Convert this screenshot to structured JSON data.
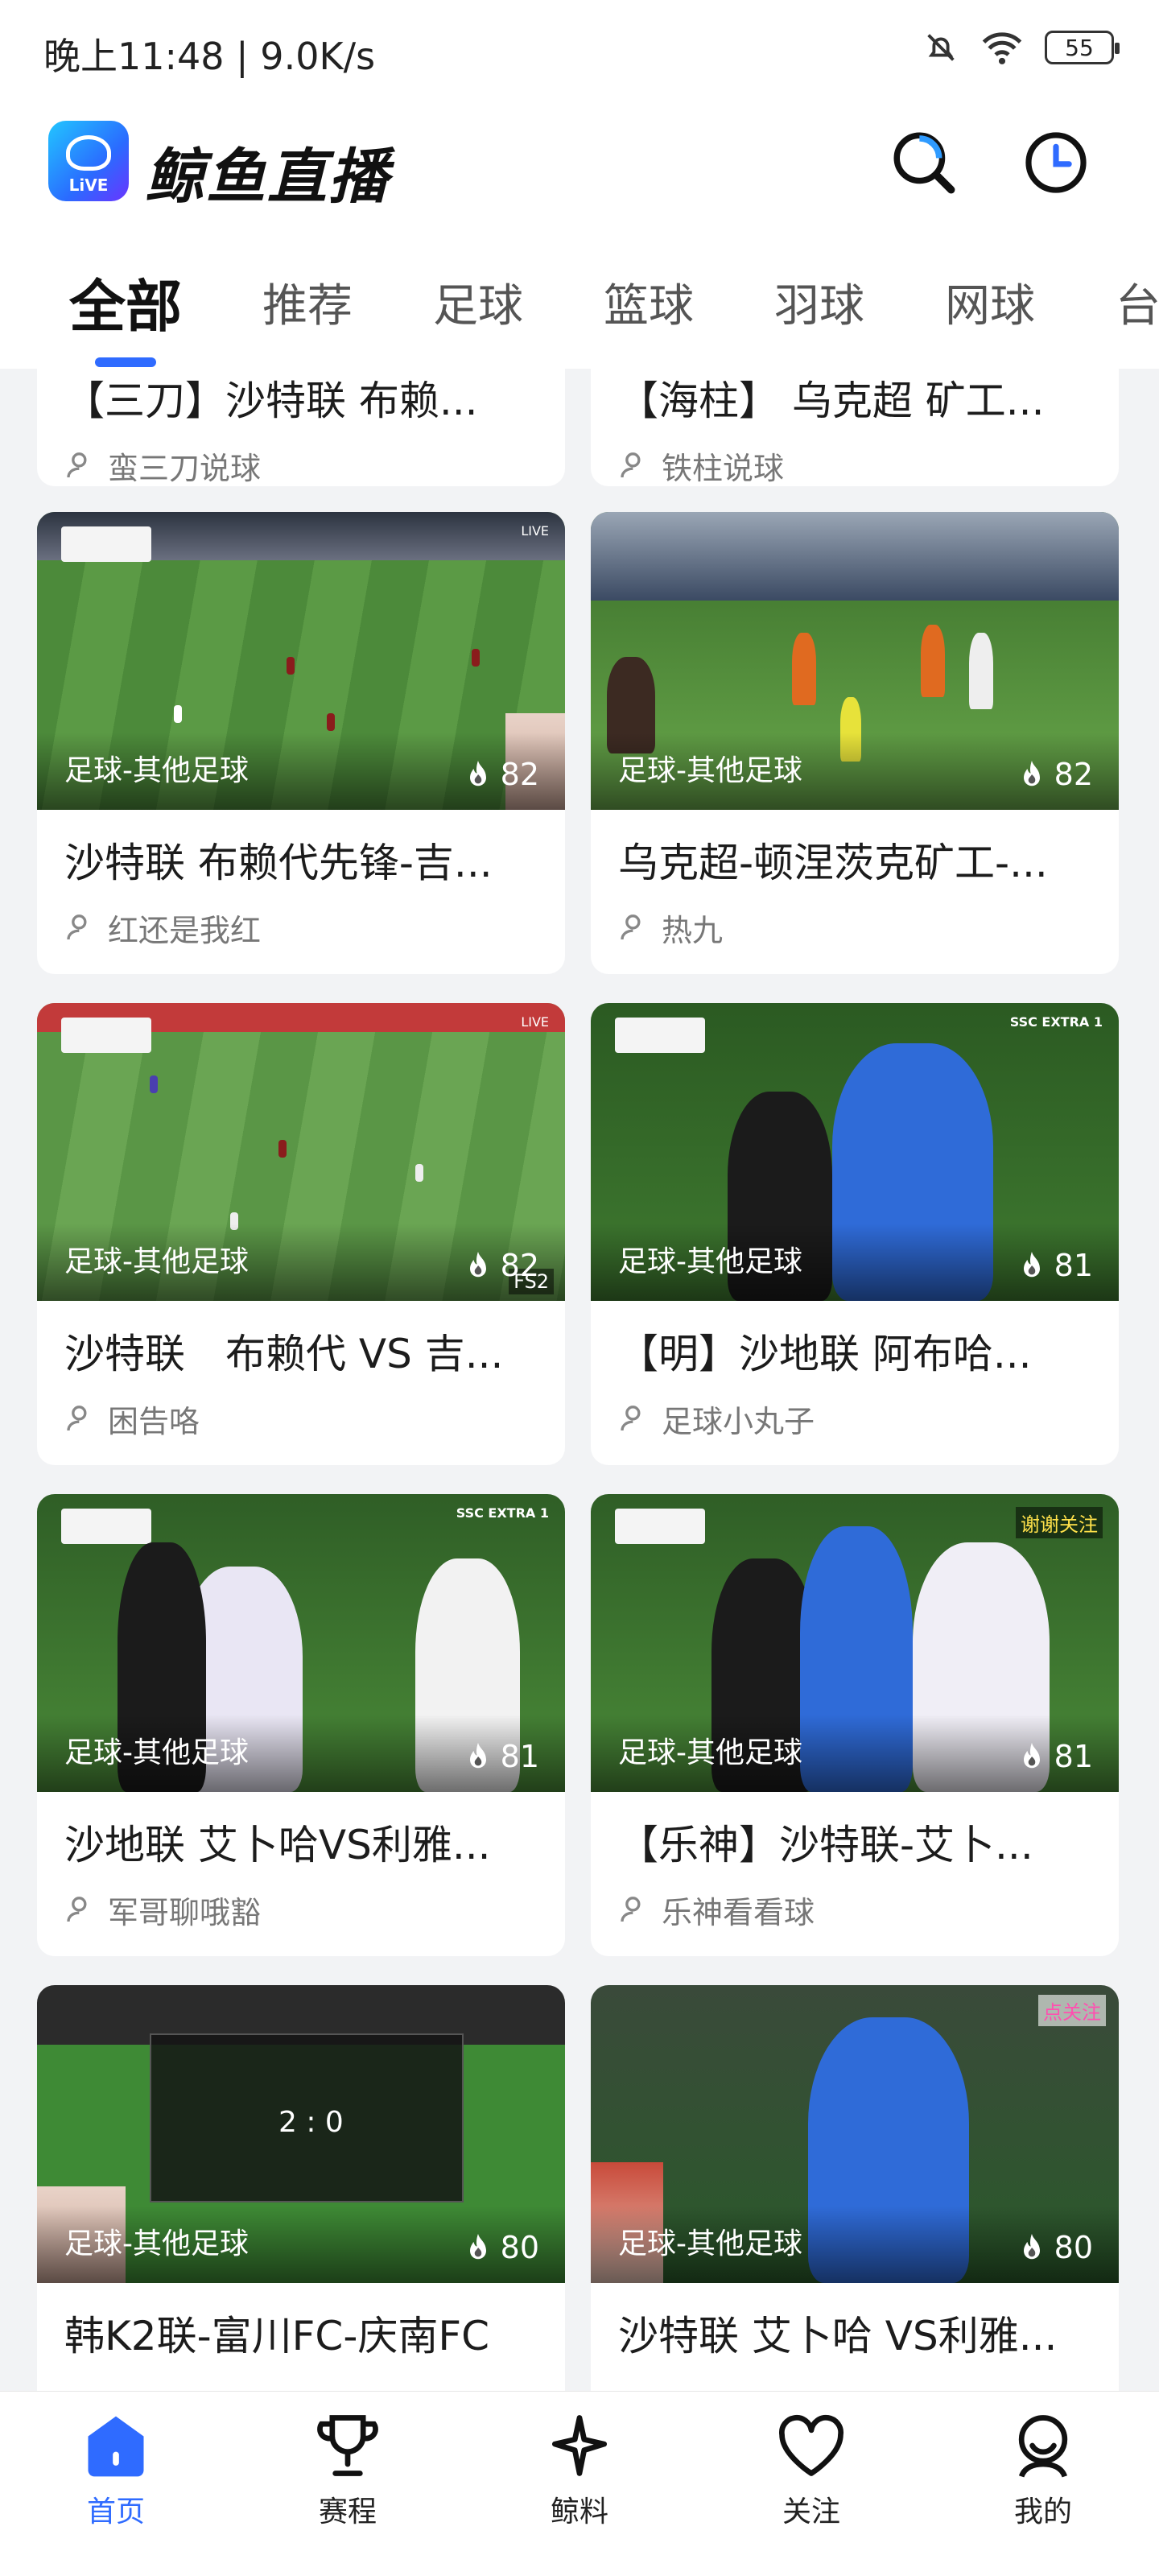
{
  "status_bar": {
    "time": "晚上11:48 | 9.0K/s",
    "battery": "55"
  },
  "header": {
    "app_name": "鲸鱼直播",
    "logo_text": "LiVE"
  },
  "tabs": [
    "全部",
    "推荐",
    "足球",
    "篮球",
    "羽球",
    "网球",
    "台"
  ],
  "cards": [
    {
      "title": "【三刀】沙特联 布赖...",
      "author": "蛮三刀说球",
      "category": "",
      "heat": ""
    },
    {
      "title": "【海柱】 乌克超 矿工...",
      "author": "铁柱说球",
      "category": "",
      "heat": ""
    },
    {
      "title": "沙特联 布赖代先锋-吉...",
      "author": "红还是我红",
      "category": "足球-其他足球",
      "heat": "82"
    },
    {
      "title": "乌克超-顿涅茨克矿工-...",
      "author": "热九",
      "category": "足球-其他足球",
      "heat": "82"
    },
    {
      "title": "沙特联　布赖代 VS 吉...",
      "author": "困告咯",
      "category": "足球-其他足球",
      "heat": "82"
    },
    {
      "title": "【明】沙地联 阿布哈...",
      "author": "足球小丸子",
      "category": "足球-其他足球",
      "heat": "81"
    },
    {
      "title": "沙地联 艾卜哈VS利雅...",
      "author": "军哥聊哦豁",
      "category": "足球-其他足球",
      "heat": "81"
    },
    {
      "title": "【乐神】沙特联-艾卜...",
      "author": "乐神看看球",
      "category": "足球-其他足球",
      "heat": "81"
    },
    {
      "title": "韩K2联-富川FC-庆南FC",
      "author": "",
      "category": "足球-其他足球",
      "heat": "80"
    },
    {
      "title": "沙特联 艾卜哈 VS利雅...",
      "author": "",
      "category": "足球-其他足球",
      "heat": "80"
    }
  ],
  "thumb_overlays": {
    "live": "LIVE",
    "fs2": "FS2",
    "ssc": "SSC EXTRA 1",
    "follow_thanks": "谢谢关注",
    "follow_click": "点关注",
    "korea_score": "2 : 0"
  },
  "bottom_nav": [
    {
      "label": "首页",
      "icon": "home-icon"
    },
    {
      "label": "赛程",
      "icon": "trophy-icon"
    },
    {
      "label": "鲸料",
      "icon": "sparkle-icon"
    },
    {
      "label": "关注",
      "icon": "heart-icon"
    },
    {
      "label": "我的",
      "icon": "profile-icon"
    }
  ],
  "colors": {
    "accent": "#2f6bff",
    "text": "#1c1c1c",
    "muted": "#777777",
    "background": "#f2f3f5"
  }
}
